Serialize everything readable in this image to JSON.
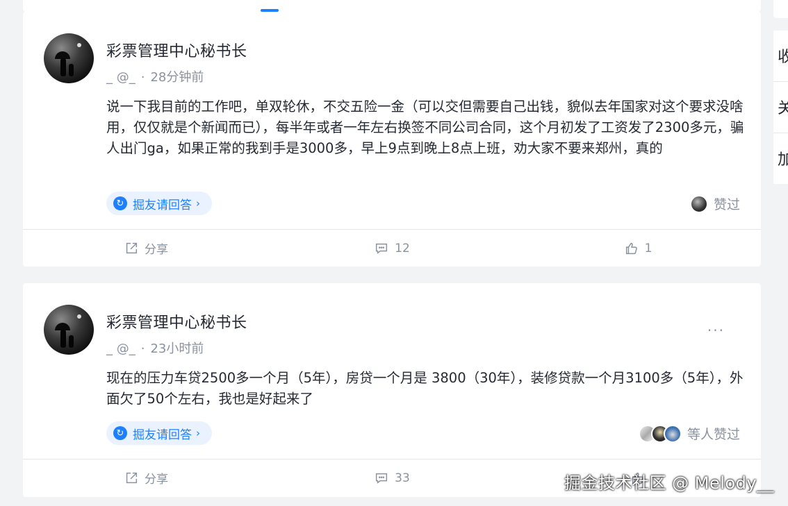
{
  "sidebar": {
    "items": [
      {
        "label": "收"
      },
      {
        "label": "关"
      },
      {
        "label": "加"
      }
    ]
  },
  "posts": [
    {
      "author": "彩票管理中心秘书长",
      "handle": "_ @_",
      "time": "28分钟前",
      "content": "说一下我目前的工作吧，单双轮休，不交五险一金（可以交但需要自己出钱，貌似去年国家对这个要求没啥用，仅仅就是个新闻而已），每半年或者一年左右换签不同公司合同，这个月初发了工资发了2300多元，骗人出门ga，如果正常的我到手是3000多，早上9点到晚上8点上班，劝大家不要来郑州，真的",
      "ask_label": "掘友请回答",
      "liked_label": "赞过",
      "share_label": "分享",
      "comments": "12",
      "likes": "1"
    },
    {
      "author": "彩票管理中心秘书长",
      "handle": "_ @_",
      "time": "23小时前",
      "more": "···",
      "content": "现在的压力车贷2500多一个月（5年），房贷一个月是 3800（30年），装修贷款一个月3100多（5年），外面欠了50个左右，我也是好起来了",
      "ask_label": "掘友请回答",
      "liked_label": "等人赞过",
      "share_label": "分享",
      "comments": "33"
    }
  ],
  "watermark": "掘金技术社区 @ Melody__",
  "colors": {
    "accent": "#1e80ff",
    "muted": "#8a919f",
    "text": "#252933",
    "background": "#f2f3f5"
  }
}
